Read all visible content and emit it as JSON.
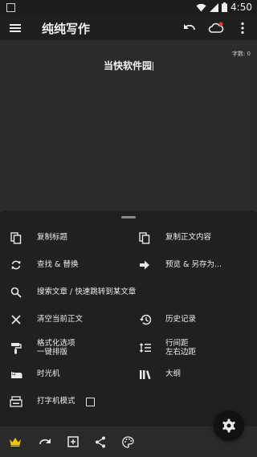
{
  "status_bar": {
    "time": "4:50"
  },
  "app_bar": {
    "title": "纯纯写作"
  },
  "editor": {
    "word_count": "字数: 0",
    "document_title": "当快软件园"
  },
  "menu": {
    "items": [
      {
        "label": "复制标题",
        "icon": "copy-icon"
      },
      {
        "label": "复制正文内容",
        "icon": "copy-icon"
      },
      {
        "label": "查找 & 替换",
        "icon": "find-replace-icon"
      },
      {
        "label": "预览 & 另存为...",
        "icon": "arrow-right-icon"
      },
      {
        "label": "搜索文章 / 快速跳转到某文章",
        "icon": "search-icon"
      },
      {
        "label": "清空当前正文",
        "icon": "close-icon"
      },
      {
        "label": "历史记录",
        "icon": "history-icon"
      },
      {
        "label_line1": "格式化选项",
        "label_line2": "一键排版",
        "icon": "format-paint-icon"
      },
      {
        "label_line1": "行间距",
        "label_line2": "左右边距",
        "icon": "line-spacing-icon"
      },
      {
        "label": "时光机",
        "icon": "time-machine-icon"
      },
      {
        "label": "大纲",
        "icon": "outline-icon"
      },
      {
        "label": "打字机模式",
        "icon": "typewriter-icon",
        "checked": false
      }
    ]
  },
  "colors": {
    "accent_crown": "#f2c200"
  }
}
